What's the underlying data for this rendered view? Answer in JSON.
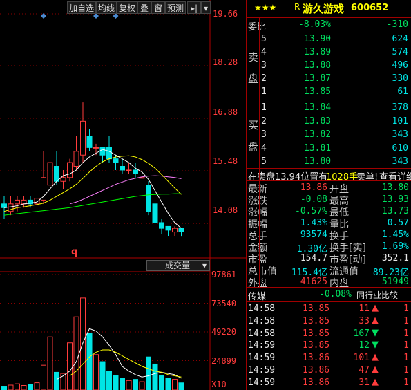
{
  "toolbar": {
    "buttons": [
      "加自选",
      "均线",
      "复权",
      "叠",
      "窗",
      "预测"
    ],
    "arrow_label": "▸|",
    "menu_label": "▾"
  },
  "price_axis": [
    "19.66",
    "18.28",
    "16.88",
    "15.48",
    "14.08"
  ],
  "volume_axis": [
    "97861",
    "73540",
    "49220",
    "24899"
  ],
  "volume_unit": "X10",
  "volume_selector": {
    "label": "成交量",
    "arrow": "▾"
  },
  "chart_marker": "q",
  "colors": {
    "up": "#ff3c3c",
    "down": "#00e5e5",
    "ma5": "#ffffff",
    "ma10": "#ffff00",
    "ma20": "#ff80ff",
    "ma60": "#00ff00"
  },
  "chart_data": {
    "type": "candlestick",
    "ylim": [
      13.4,
      19.66
    ],
    "vol_ylim": [
      0,
      97861
    ],
    "candles": [
      {
        "o": 14.6,
        "c": 14.5,
        "h": 14.8,
        "l": 14.2
      },
      {
        "o": 14.4,
        "c": 14.6,
        "h": 14.8,
        "l": 14.3
      },
      {
        "o": 14.6,
        "c": 14.7,
        "h": 14.8,
        "l": 14.4
      },
      {
        "o": 14.6,
        "c": 14.7,
        "h": 14.8,
        "l": 14.5
      },
      {
        "o": 14.7,
        "c": 14.6,
        "h": 14.8,
        "l": 14.5
      },
      {
        "o": 14.6,
        "c": 14.75,
        "h": 14.8,
        "l": 14.5
      },
      {
        "o": 14.7,
        "c": 15.3,
        "h": 16.0,
        "l": 14.6
      },
      {
        "o": 15.1,
        "c": 15.7,
        "h": 16.0,
        "l": 14.9
      },
      {
        "o": 15.6,
        "c": 15.2,
        "h": 16.0,
        "l": 15.1
      },
      {
        "o": 15.2,
        "c": 15.3,
        "h": 15.5,
        "l": 15.0
      },
      {
        "o": 15.3,
        "c": 15.7,
        "h": 15.8,
        "l": 15.2
      },
      {
        "o": 15.6,
        "c": 16.0,
        "h": 16.4,
        "l": 15.5
      },
      {
        "o": 15.9,
        "c": 16.8,
        "h": 17.3,
        "l": 15.7
      },
      {
        "o": 16.4,
        "c": 16.1,
        "h": 16.6,
        "l": 16.0
      },
      {
        "o": 16.1,
        "c": 16.1,
        "h": 16.2,
        "l": 15.9
      },
      {
        "o": 16.1,
        "c": 15.9,
        "h": 16.1,
        "l": 15.7
      },
      {
        "o": 16.1,
        "c": 15.8,
        "h": 16.4,
        "l": 15.7
      },
      {
        "o": 15.8,
        "c": 15.7,
        "h": 15.9,
        "l": 15.5
      },
      {
        "o": 15.6,
        "c": 15.5,
        "h": 15.8,
        "l": 15.4
      },
      {
        "o": 15.5,
        "c": 15.5,
        "h": 15.7,
        "l": 15.4
      },
      {
        "o": 15.5,
        "c": 15.4,
        "h": 15.7,
        "l": 15.3
      },
      {
        "o": 15.3,
        "c": 15.3,
        "h": 15.4,
        "l": 15.2
      },
      {
        "o": 15.1,
        "c": 14.4,
        "h": 15.2,
        "l": 14.3
      },
      {
        "o": 14.6,
        "c": 14.1,
        "h": 14.7,
        "l": 13.8
      },
      {
        "o": 14.1,
        "c": 13.95,
        "h": 14.2,
        "l": 13.8
      },
      {
        "o": 14.0,
        "c": 13.9,
        "h": 14.0,
        "l": 13.75
      },
      {
        "o": 13.85,
        "c": 13.95,
        "h": 14.0,
        "l": 13.75
      },
      {
        "o": 13.95,
        "c": 13.86,
        "h": 13.95,
        "l": 13.73
      }
    ],
    "volumes": [
      3200,
      4100,
      5200,
      3800,
      4400,
      6100,
      21000,
      45000,
      15000,
      14000,
      40000,
      62000,
      78000,
      48000,
      30000,
      24000,
      16000,
      12000,
      10000,
      8000,
      9000,
      7000,
      28000,
      22000,
      12000,
      10000,
      9000,
      6000
    ],
    "ma5": [
      14.5,
      14.52,
      14.55,
      14.6,
      14.62,
      14.65,
      14.8,
      15.0,
      15.2,
      15.35,
      15.4,
      15.5,
      15.7,
      15.85,
      15.95,
      16.05,
      16.0,
      15.9,
      15.8,
      15.7,
      15.55,
      15.45,
      15.25,
      14.95,
      14.65,
      14.35,
      14.1,
      13.95
    ],
    "ma10": [
      14.4,
      14.45,
      14.5,
      14.52,
      14.55,
      14.58,
      14.62,
      14.7,
      14.8,
      14.9,
      15.0,
      15.12,
      15.28,
      15.45,
      15.6,
      15.72,
      15.8,
      15.85,
      15.87,
      15.88,
      15.85,
      15.78,
      15.68,
      15.55,
      15.38,
      15.2,
      15.02,
      14.85
    ],
    "ma20": [
      null,
      null,
      null,
      null,
      null,
      null,
      null,
      null,
      null,
      null,
      14.6,
      14.65,
      14.72,
      14.8,
      14.88,
      14.96,
      15.04,
      15.12,
      15.18,
      15.24,
      15.28,
      15.32,
      15.34,
      15.35,
      15.34,
      15.32,
      15.3,
      15.27
    ],
    "ma60": [
      14.3,
      14.32,
      14.34,
      14.36,
      14.38,
      14.4,
      14.42,
      14.44,
      14.46,
      14.48,
      14.5,
      14.53,
      14.56,
      14.59,
      14.62,
      14.65,
      14.68,
      14.71,
      14.74,
      14.77,
      14.8,
      14.82,
      14.84,
      14.85,
      14.86,
      14.86,
      14.87,
      14.87
    ],
    "vol_ma1": [
      null,
      null,
      null,
      null,
      null,
      null,
      null,
      null,
      9000,
      12000,
      16000,
      24000,
      40000,
      52000,
      50000,
      45000,
      38000,
      30000,
      20000,
      16000,
      13000,
      11000,
      12000,
      14000,
      15000,
      14000,
      13000,
      10000
    ],
    "vol_ma2": [
      null,
      null,
      null,
      null,
      null,
      null,
      null,
      null,
      null,
      null,
      12000,
      16000,
      22000,
      28000,
      32000,
      34000,
      34000,
      32000,
      29000,
      26000,
      23000,
      20000,
      18000,
      16000,
      15000,
      13000,
      12000,
      11000
    ],
    "diamonds_x_index": [
      6,
      14,
      17
    ]
  },
  "quote": {
    "stars": "★★★",
    "r_badge": "R",
    "name": "游久游戏",
    "code": "600652",
    "webi_label": "委比",
    "webi_pct": "-8.03%",
    "webi_val": "-310",
    "sell_label": [
      "卖",
      "盘"
    ],
    "buy_label": [
      "买",
      "盘"
    ],
    "asks": [
      {
        "lvl": "5",
        "price": "13.90",
        "vol": "624"
      },
      {
        "lvl": "4",
        "price": "13.89",
        "vol": "574"
      },
      {
        "lvl": "3",
        "price": "13.88",
        "vol": "496"
      },
      {
        "lvl": "2",
        "price": "13.87",
        "vol": "330"
      },
      {
        "lvl": "1",
        "price": "13.85",
        "vol": "61"
      }
    ],
    "bids": [
      {
        "lvl": "1",
        "price": "13.84",
        "vol": "378"
      },
      {
        "lvl": "2",
        "price": "13.83",
        "vol": "101"
      },
      {
        "lvl": "3",
        "price": "13.82",
        "vol": "343"
      },
      {
        "lvl": "4",
        "price": "13.81",
        "vol": "610"
      },
      {
        "lvl": "5",
        "price": "13.80",
        "vol": "343"
      }
    ],
    "notice": {
      "text": "在卖盘13.94位置有",
      "vol": "1028手",
      "action": "卖单!",
      "link": "查看详细"
    },
    "stats": [
      {
        "l1": "最新",
        "v1": "13.86",
        "c1": "red",
        "l2": "开盘",
        "v2": "13.80",
        "c2": "grn"
      },
      {
        "l1": "涨跌",
        "v1": "-0.08",
        "c1": "grn",
        "l2": "最高",
        "v2": "13.93",
        "c2": "grn"
      },
      {
        "l1": "涨幅",
        "v1": "-0.57%",
        "c1": "grn",
        "l2": "最低",
        "v2": "13.73",
        "c2": "grn"
      },
      {
        "l1": "振幅",
        "v1": "1.43%",
        "c1": "cyan",
        "l2": "量比",
        "v2": "0.57",
        "c2": "cyan"
      },
      {
        "l1": "总手",
        "v1": "93574",
        "c1": "cyan",
        "l2": "换手",
        "v2": "1.45%",
        "c2": "cyan"
      },
      {
        "l1": "金额",
        "v1": "1.30亿",
        "c1": "cyan",
        "l2": "换手[实]",
        "v2": "1.69%",
        "c2": "cyan"
      },
      {
        "l1": "市盈",
        "v1": "154.7",
        "c1": "wht",
        "l2": "市盈[动]",
        "v2": "352.1",
        "c2": "wht"
      },
      {
        "l1": "总市值",
        "v1": "115.4亿",
        "c1": "cyan",
        "l2": "流通值",
        "v2": "89.23亿",
        "c2": "cyan"
      },
      {
        "l1": "外盘",
        "v1": "41625",
        "c1": "red",
        "l2": "内盘",
        "v2": "51949",
        "c2": "grn"
      }
    ],
    "industry": {
      "name": "传媒",
      "pct": "-0.08%",
      "compare": "同行业比较"
    },
    "ticks": [
      {
        "time": "14:58",
        "price": "13.85",
        "vol": "11",
        "dir": "up",
        "extra": "1"
      },
      {
        "time": "14:58",
        "price": "13.85",
        "vol": "33",
        "dir": "up",
        "extra": "1"
      },
      {
        "time": "14:58",
        "price": "13.85",
        "vol": "167",
        "dir": "down",
        "extra": "1"
      },
      {
        "time": "14:59",
        "price": "13.85",
        "vol": "12",
        "dir": "down",
        "extra": "1"
      },
      {
        "time": "14:59",
        "price": "13.86",
        "vol": "101",
        "dir": "up",
        "extra": "1"
      },
      {
        "time": "14:59",
        "price": "13.86",
        "vol": "47",
        "dir": "up",
        "extra": "1"
      },
      {
        "time": "14:59",
        "price": "13.86",
        "vol": "31",
        "dir": "up",
        "extra": "1"
      }
    ]
  }
}
